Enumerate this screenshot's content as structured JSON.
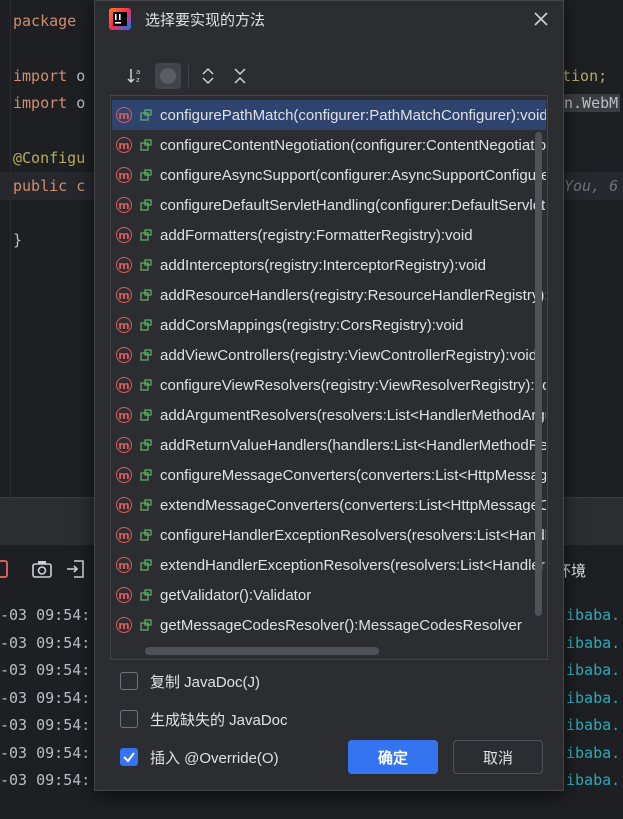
{
  "editor": {
    "package_kw": "package",
    "import_kw": "import",
    "import_frag": "o",
    "import1_right": "tion;",
    "import2_right": "n.WebM",
    "annotation": "@Configu",
    "public_kw": "public",
    "class_frag": "c",
    "inline_hint": "You, 6",
    "closing_brace": "}"
  },
  "console": {
    "env_label": "环境",
    "timestamps": [
      "-03 09:54:",
      "-03 09:54:",
      "-03 09:54:",
      "-03 09:54:",
      "-03 09:54:",
      "-03 09:54:",
      "-03 09:54:"
    ],
    "right_text": [
      "ibaba.",
      "ibaba.",
      "ibaba.",
      "ibaba.",
      "ibaba.",
      "ibaba.",
      "ibaba."
    ]
  },
  "dialog": {
    "title": "选择要实现的方法",
    "methods": [
      "configurePathMatch(configurer:PathMatchConfigurer):void",
      "configureContentNegotiation(configurer:ContentNegotiationConfigurer):void",
      "configureAsyncSupport(configurer:AsyncSupportConfigurer):void",
      "configureDefaultServletHandling(configurer:DefaultServletHandlerConfigurer):void",
      "addFormatters(registry:FormatterRegistry):void",
      "addInterceptors(registry:InterceptorRegistry):void",
      "addResourceHandlers(registry:ResourceHandlerRegistry):void",
      "addCorsMappings(registry:CorsRegistry):void",
      "addViewControllers(registry:ViewControllerRegistry):void",
      "configureViewResolvers(registry:ViewResolverRegistry):void",
      "addArgumentResolvers(resolvers:List<HandlerMethodArgumentResolver>):void",
      "addReturnValueHandlers(handlers:List<HandlerMethodReturnValueHandler>):void",
      "configureMessageConverters(converters:List<HttpMessageConverter<?>>):void",
      "extendMessageConverters(converters:List<HttpMessageConverter<?>>):void",
      "configureHandlerExceptionResolvers(resolvers:List<HandlerExceptionResolver>):void",
      "extendHandlerExceptionResolvers(resolvers:List<HandlerExceptionResolver>):void",
      "getValidator():Validator",
      "getMessageCodesResolver():MessageCodesResolver"
    ],
    "method_icon_letter": "m",
    "options": {
      "copy_javadoc": "复制 JavaDoc(J)",
      "generate_javadoc": "生成缺失的 JavaDoc",
      "insert_override": "插入 @Override(O)"
    },
    "ok_label": "确定",
    "cancel_label": "取消"
  },
  "colors": {
    "accent": "#3574f0",
    "selection": "#2e436e",
    "method_icon": "#db5c5c",
    "dialog_bg": "#2b2d30"
  }
}
